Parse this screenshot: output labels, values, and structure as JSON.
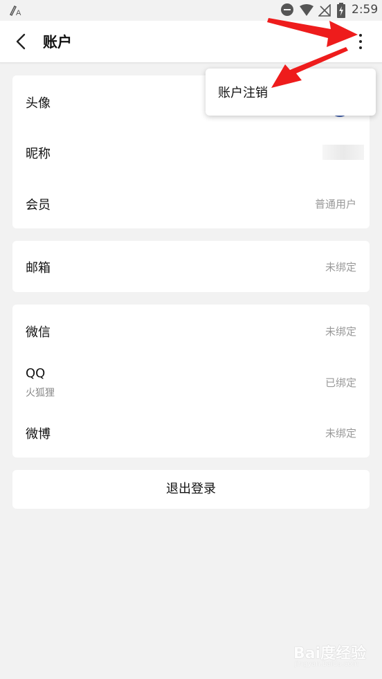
{
  "status_bar": {
    "time": "2:59"
  },
  "header": {
    "title": "账户"
  },
  "menu": {
    "item": "账户注销"
  },
  "profile": {
    "avatar_label": "头像",
    "nickname_label": "昵称",
    "member_label": "会员",
    "member_value": "普通用户"
  },
  "email": {
    "label": "邮箱",
    "value": "未绑定"
  },
  "bindings": {
    "wechat_label": "微信",
    "wechat_value": "未绑定",
    "qq_label": "QQ",
    "qq_name": "火狐狸",
    "qq_value": "已绑定",
    "weibo_label": "微博",
    "weibo_value": "未绑定"
  },
  "logout_label": "退出登录",
  "watermark": {
    "brand": "Bai度经验",
    "url": "jingyan.baidu.com"
  },
  "colors": {
    "annotation_arrow": "#ee1c1c",
    "background": "#f2f2f2"
  }
}
